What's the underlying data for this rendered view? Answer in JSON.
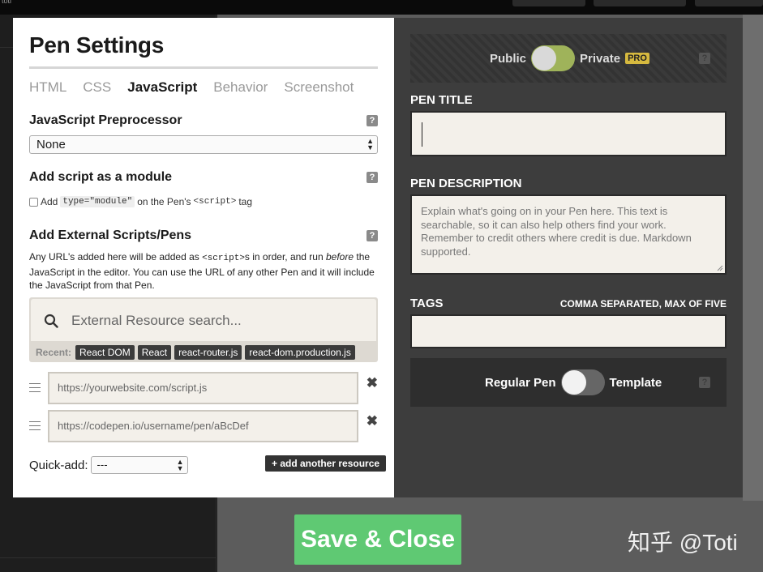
{
  "background": {
    "top_bar_text": "toti"
  },
  "settings": {
    "title": "Pen Settings",
    "tabs": [
      {
        "label": "HTML",
        "active": false
      },
      {
        "label": "CSS",
        "active": false
      },
      {
        "label": "JavaScript",
        "active": true
      },
      {
        "label": "Behavior",
        "active": false
      },
      {
        "label": "Screenshot",
        "active": false
      }
    ],
    "help_glyph": "?",
    "preprocessor": {
      "heading": "JavaScript Preprocessor",
      "value": "None"
    },
    "module": {
      "heading": "Add script as a module",
      "prefix": "Add",
      "code": "type=\"module\"",
      "middle": "on the Pen's",
      "tag": "<script>",
      "suffix": "tag",
      "checked": false
    },
    "external": {
      "heading": "Add External Scripts/Pens",
      "desc_1": "Any URL's added here will be added as",
      "desc_code": "<script>",
      "desc_2": "s in order, and run",
      "desc_em": "before",
      "desc_3": "the JavaScript in the editor. You can use the URL of any other Pen and it will include the JavaScript from that Pen.",
      "search_placeholder": "External Resource search...",
      "recent_label": "Recent:",
      "recent": [
        "React DOM",
        "React",
        "react-router.js",
        "react-dom.production.js"
      ],
      "resources": [
        {
          "placeholder": "https://yourwebsite.com/script.js"
        },
        {
          "placeholder": "https://codepen.io/username/pen/aBcDef"
        }
      ],
      "remove_glyph": "✖",
      "quick_add_label": "Quick-add:",
      "quick_add_value": "---",
      "add_another": "+ add another resource"
    }
  },
  "details": {
    "privacy": {
      "public_label": "Public",
      "private_label": "Private",
      "pro_badge": "PRO"
    },
    "pen_title": {
      "label": "PEN TITLE",
      "value": ""
    },
    "pen_description": {
      "label": "PEN DESCRIPTION",
      "placeholder": "Explain what's going on in your Pen here. This text is searchable, so it can also help others find your work. Remember to credit others where credit is due. Markdown supported."
    },
    "tags": {
      "label": "TAGS",
      "hint": "COMMA SEPARATED, MAX OF FIVE",
      "value": ""
    },
    "template": {
      "regular_label": "Regular Pen",
      "template_label": "Template"
    }
  },
  "footer": {
    "save_close": "Save & Close",
    "watermark": "知乎 @Toti"
  },
  "colors": {
    "save_green": "#5fc973",
    "pro_gold": "#d6b93f",
    "toggle_green": "#9fb35a"
  }
}
